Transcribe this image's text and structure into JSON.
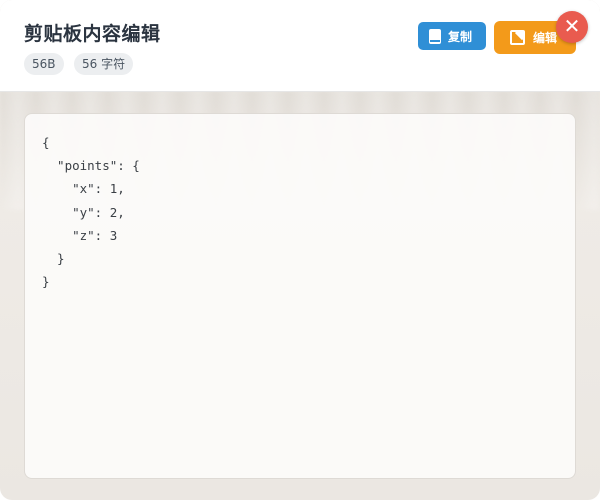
{
  "header": {
    "title": "剪贴板内容编辑",
    "badges": {
      "size": "56B",
      "chars": "56 字符"
    },
    "buttons": {
      "copy_label": "复制",
      "edit_label": "编辑",
      "close_label": "✕"
    },
    "colors": {
      "copy": "#2f8fd6",
      "edit": "#f39a1a",
      "close": "#e95b4f"
    },
    "icons": {
      "copy": "clipboard-icon",
      "edit": "edit-icon",
      "close": "close-icon"
    }
  },
  "content": {
    "text": "{\n  \"points\": {\n    \"x\": 1,\n    \"y\": 2,\n    \"z\": 3\n  }\n}"
  }
}
